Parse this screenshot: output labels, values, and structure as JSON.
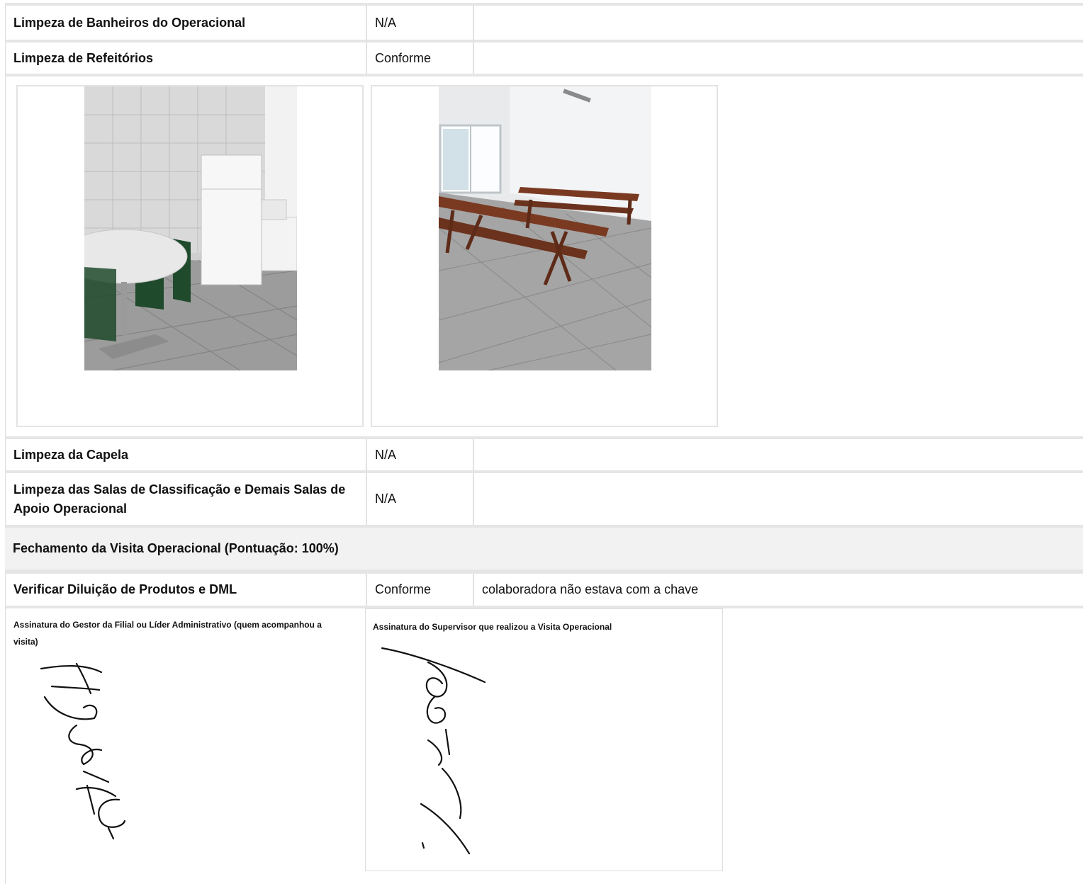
{
  "rows": [
    {
      "label": "Limpeza de Banheiros do Operacional",
      "status": "N/A",
      "comment": ""
    },
    {
      "label": "Limpeza de Refeitórios",
      "status": "Conforme",
      "comment": ""
    },
    {
      "label": "Limpeza da Capela",
      "status": "N/A",
      "comment": ""
    },
    {
      "label": "Limpeza das Salas de Classificação e Demais Salas de Apoio Operacional",
      "status": "N/A",
      "comment": ""
    }
  ],
  "photos": [
    {
      "subject": "kitchen with round table, green chairs, white refrigerator and microwave"
    },
    {
      "subject": "dining room with wooden tables and benches, window and ceiling lamp"
    }
  ],
  "section": {
    "title": "Fechamento da Visita Operacional (Pontuação: 100%)"
  },
  "closing_row": {
    "label": "Verificar Diluição de Produtos e DML",
    "status": "Conforme",
    "comment": "colaboradora não estava com a chave"
  },
  "signatures": {
    "manager": {
      "label": "Assinatura do Gestor da Filial ou Líder Administrativo (quem acompanhou a visita)",
      "text": "AUSENTE"
    },
    "supervisor": {
      "label": "Assinatura do Supervisor que realizou a Visita Operacional"
    }
  },
  "colors": {
    "header_bg": "#f2f2f2",
    "border": "#e5e5e5",
    "wood": "#7a3a22"
  }
}
